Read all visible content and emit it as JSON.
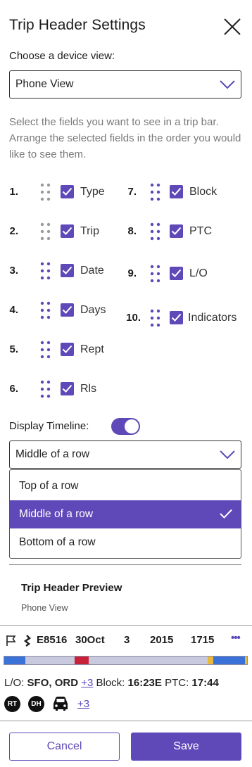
{
  "header": {
    "title": "Trip Header Settings"
  },
  "device": {
    "label": "Choose a device view:",
    "selected": "Phone View"
  },
  "description": "Select the fields you want to see in a trip bar. Arrange the selected fields in the order you would like to see them.",
  "fields_left": [
    {
      "num": "1.",
      "label": "Type",
      "checked": true
    },
    {
      "num": "2.",
      "label": "Trip",
      "checked": true
    },
    {
      "num": "3.",
      "label": "Date",
      "checked": true
    },
    {
      "num": "4.",
      "label": "Days",
      "checked": true
    },
    {
      "num": "5.",
      "label": "Rept",
      "checked": true
    },
    {
      "num": "6.",
      "label": "Rls",
      "checked": true
    }
  ],
  "fields_right": [
    {
      "num": "7.",
      "label": "Block",
      "checked": true
    },
    {
      "num": "8.",
      "label": "PTC",
      "checked": true
    },
    {
      "num": "9.",
      "label": "L/O",
      "checked": true
    },
    {
      "num": "10.",
      "label": "Indicators",
      "checked": true
    }
  ],
  "timeline": {
    "label": "Display Timeline:",
    "enabled": true,
    "selected": "Middle of a row",
    "options": [
      "Top of  a row",
      "Middle of a row",
      "Bottom of a row"
    ]
  },
  "preview": {
    "title": "Trip Header Preview",
    "subtitle": "Phone View",
    "trip": {
      "id": "E8516",
      "date": "30Oct",
      "days": "3",
      "rept": "2015",
      "rls": "1715",
      "more": "•••"
    },
    "info": {
      "lo_label": "L/O:",
      "lo_value": "SFO, ORD",
      "lo_more": "+3",
      "block_label": "Block:",
      "block_value": "16:23E",
      "ptc_label": "PTC:",
      "ptc_value": "17:44"
    },
    "indicators": {
      "badge1": "RT",
      "badge2": "DH",
      "more": "+3"
    }
  },
  "colors": {
    "accent": "#5f49b8",
    "bar_blue": "#3a72d8",
    "bar_red": "#c8223a",
    "bar_yellow": "#e8b93a",
    "bar_base": "#c9c9dd"
  },
  "buttons": {
    "cancel": "Cancel",
    "save": "Save"
  }
}
